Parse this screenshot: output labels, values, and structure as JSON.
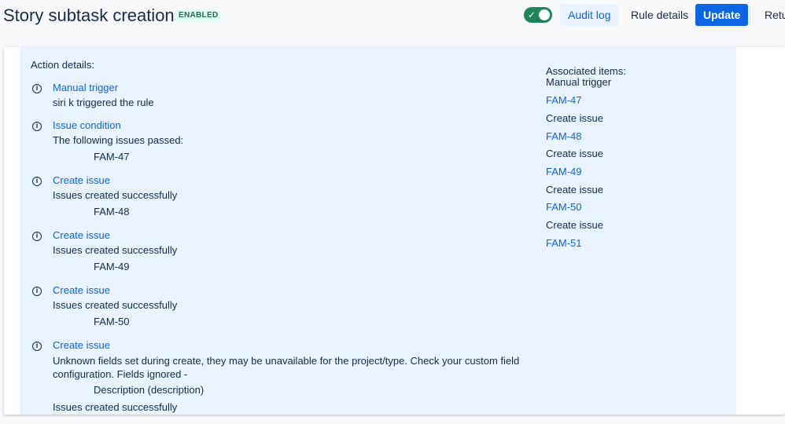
{
  "header": {
    "title": "Story subtask creation",
    "status_badge": "ENABLED",
    "toggle_state": "on",
    "audit_log_label": "Audit log",
    "rule_details_label": "Rule details",
    "update_label": "Update",
    "return_label": "Retu"
  },
  "action_details": {
    "heading": "Action details:",
    "entries": [
      {
        "title": "Manual trigger",
        "description": "siri k triggered the rule"
      },
      {
        "title": "Issue condition",
        "description": "The following issues passed:",
        "issue": "FAM-47"
      },
      {
        "title": "Create issue",
        "description": "Issues created successfully",
        "issue": "FAM-48"
      },
      {
        "title": "Create issue",
        "description": "Issues created successfully",
        "issue": "FAM-49"
      },
      {
        "title": "Create issue",
        "description": "Issues created successfully",
        "issue": "FAM-50"
      },
      {
        "title": "Create issue",
        "warning": "Unknown fields set during create, they may be unavailable for the project/type. Check your custom field configuration. Fields ignored -",
        "ignored_field": "Description (description)",
        "description": "Issues created successfully"
      }
    ]
  },
  "associated_items": {
    "heading": "Associated items:",
    "items": [
      {
        "label": "Manual trigger",
        "type": "text"
      },
      {
        "label": "FAM-47",
        "type": "link"
      },
      {
        "label": "Create issue",
        "type": "text"
      },
      {
        "label": "FAM-48",
        "type": "link"
      },
      {
        "label": "Create issue",
        "type": "text"
      },
      {
        "label": "FAM-49",
        "type": "link"
      },
      {
        "label": "Create issue",
        "type": "text"
      },
      {
        "label": "FAM-50",
        "type": "link"
      },
      {
        "label": "Create issue",
        "type": "text"
      },
      {
        "label": "FAM-51",
        "type": "link"
      }
    ]
  },
  "colors": {
    "link": "#0c66e4",
    "panel_background": "#e9f2ff",
    "toggle_on": "#1f845a",
    "primary_button": "#0c66e4"
  }
}
